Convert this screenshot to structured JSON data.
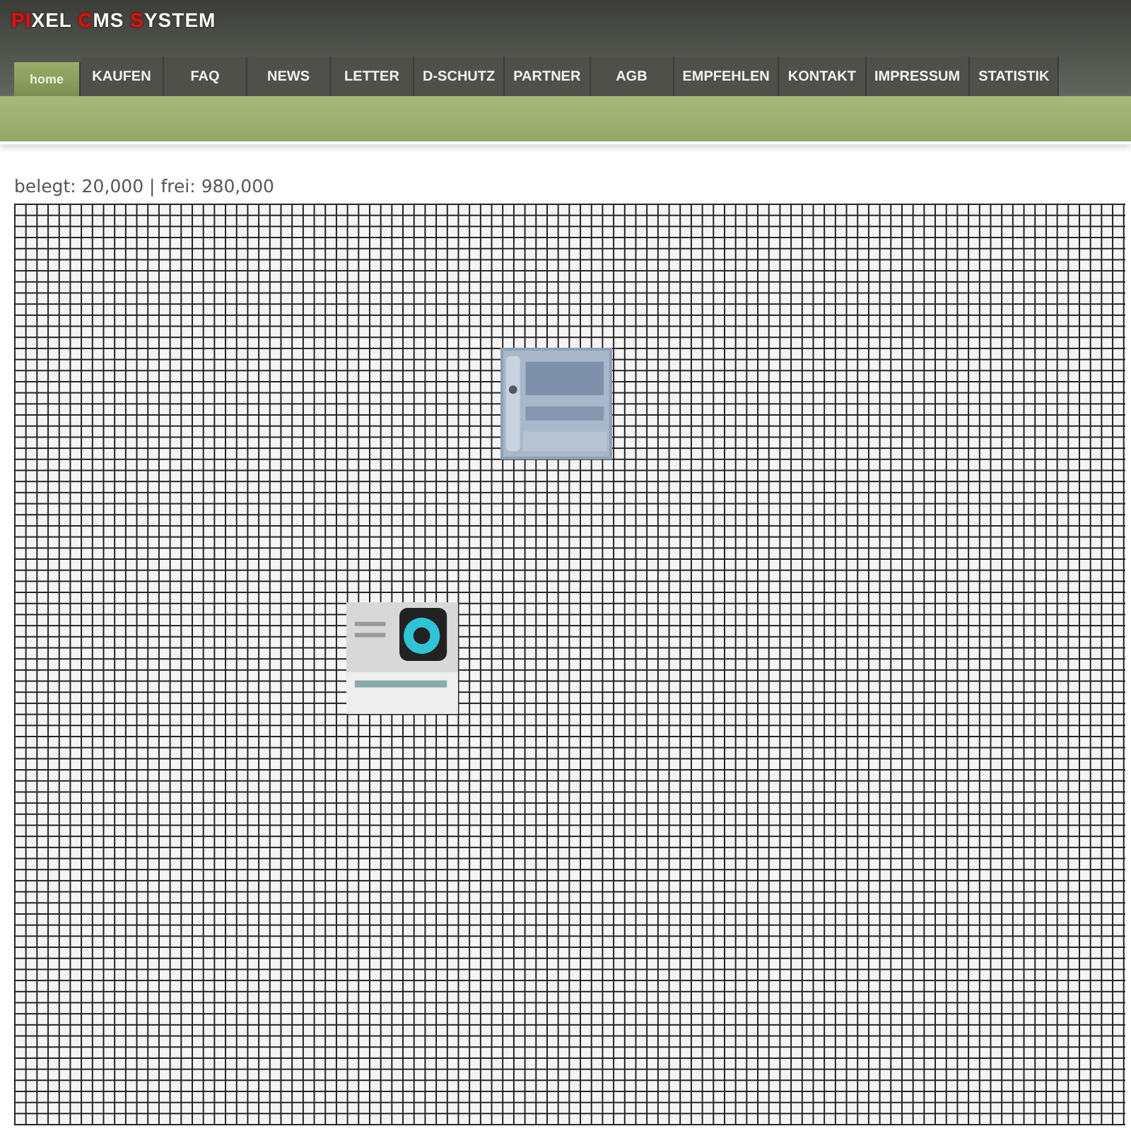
{
  "logo": [
    {
      "text": "PI",
      "accent": true
    },
    {
      "text": "XEL ",
      "accent": false
    },
    {
      "text": "C",
      "accent": true
    },
    {
      "text": "MS ",
      "accent": false
    },
    {
      "text": "S",
      "accent": true
    },
    {
      "text": "YSTEM",
      "accent": false
    }
  ],
  "nav": [
    {
      "label": "home",
      "selected": true
    },
    {
      "label": "KAUFEN",
      "selected": false
    },
    {
      "label": "FAQ",
      "selected": false
    },
    {
      "label": "NEWS",
      "selected": false
    },
    {
      "label": "LETTER",
      "selected": false
    },
    {
      "label": "D-SCHUTZ",
      "selected": false
    },
    {
      "label": "PARTNER",
      "selected": false
    },
    {
      "label": "AGB",
      "selected": false
    },
    {
      "label": "EMPFEHLEN",
      "selected": false
    },
    {
      "label": "KONTAKT",
      "selected": false
    },
    {
      "label": "IMPRESSUM",
      "selected": false
    },
    {
      "label": "STATISTIK",
      "selected": false
    }
  ],
  "stats": "belegt: 20,000 | frei: 980,000"
}
